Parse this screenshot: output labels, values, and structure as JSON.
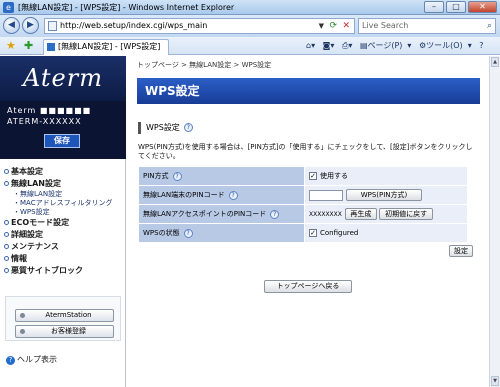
{
  "window": {
    "title": "[無線LAN設定] - [WPS設定] - Windows Internet Explorer",
    "min": "–",
    "max": "□",
    "close": "✕"
  },
  "address": {
    "url": "http://web.setup/index.cgi/wps_main",
    "search_placeholder": "Live Search"
  },
  "tab": {
    "label": "[無線LAN設定] - [WPS設定]",
    "page_menu": "ページ(P)",
    "tools_menu": "ツール(O)",
    "help_menu": "?"
  },
  "sidebar": {
    "logo": "Aterm",
    "model_line1": "Aterm ■■■■■■",
    "model_line2": "ATERM-XXXXXX",
    "save_label": "保存",
    "menu": [
      {
        "label": "基本設定"
      },
      {
        "label": "無線LAN設定"
      },
      {
        "label": "ECOモード設定"
      },
      {
        "label": "詳細設定"
      },
      {
        "label": "メンテナンス"
      },
      {
        "label": "情報"
      },
      {
        "label": "悪質サイトブロック"
      }
    ],
    "submenu": [
      "・無線LAN設定",
      "・MACアドレスフィルタリング",
      "・WPS設定"
    ],
    "aterm_station": "AtermStation",
    "customer_reg": "お客様登録",
    "help": "ヘルプ表示"
  },
  "main": {
    "breadcrumb": "トップページ > 無線LAN設定 > WPS設定",
    "header": "WPS設定",
    "section": "WPS設定",
    "description": "WPS(PIN方式)を使用する場合は、[PIN方式]の「使用する」にチェックをして、[設定]ボタンをクリックしてください。",
    "rows": {
      "pin_method_label": "PIN方式",
      "pin_method_value": "使用する",
      "client_pin_label": "無線LAN端末のPINコード",
      "client_pin_button": "WPS(PIN方式)",
      "ap_pin_label": "無線LANアクセスポイントのPINコード",
      "ap_pin_value": "XXXXXXXX",
      "regen_button": "再生成",
      "reset_button": "初期値に戻す",
      "status_label": "WPSの状態",
      "status_value": "Configured"
    },
    "set_button": "設定",
    "top_button": "トップページへ戻る"
  }
}
